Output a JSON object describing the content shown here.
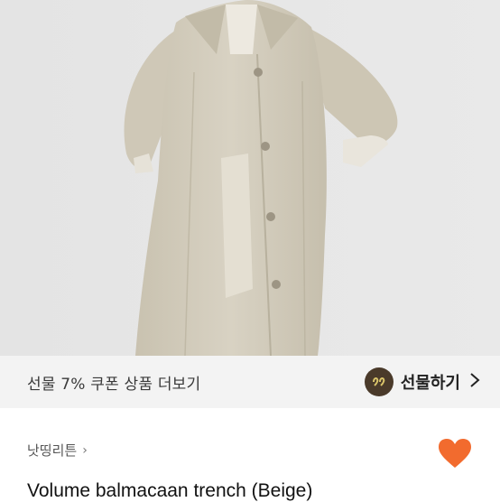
{
  "gift_banner": {
    "promo_text": "선물 7% 쿠폰 상품 더보기",
    "action_label": "선물하기",
    "logo_icon": "gift-brand-logo-icon",
    "chevron_icon": "chevron-right-icon"
  },
  "store": {
    "name": "낫띵리튼",
    "chevron": "›"
  },
  "product": {
    "title": "Volume balmacaan trench (Beige)",
    "like_icon": "heart-icon",
    "like_color": "#f26b2e"
  },
  "colors": {
    "banner_bg": "#f3f3f3",
    "photo_bg": "#e6e6e6",
    "coat": "#d3cdbd"
  }
}
